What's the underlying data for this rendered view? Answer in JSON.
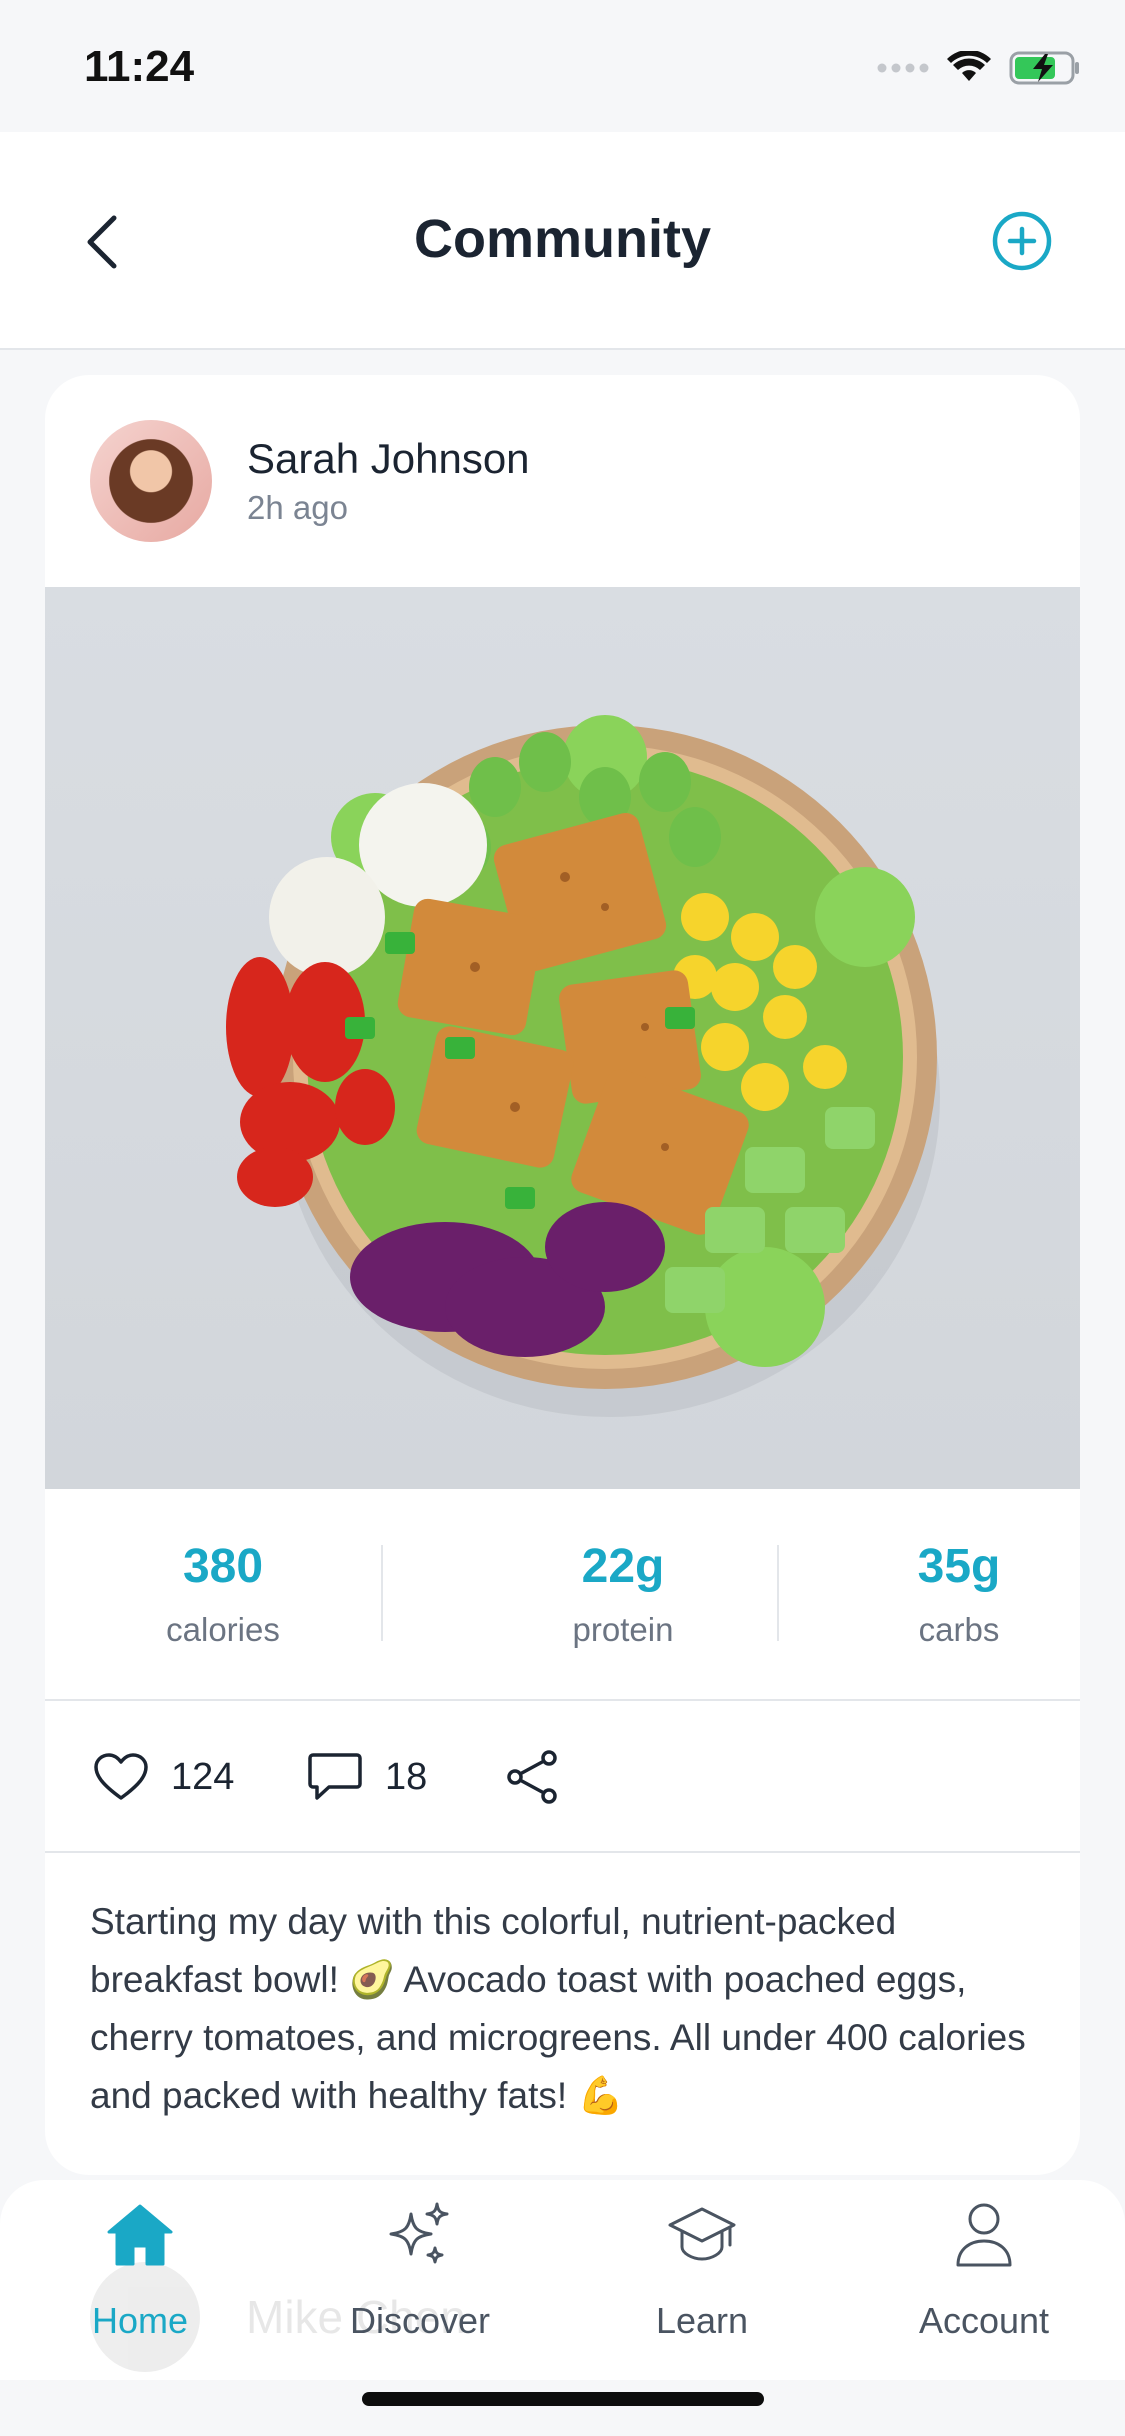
{
  "status_bar": {
    "time": "11:24"
  },
  "nav": {
    "title": "Community"
  },
  "post": {
    "author": "Sarah Johnson",
    "time_ago": "2h ago",
    "macros": [
      {
        "value": "380",
        "label": "calories"
      },
      {
        "value": "22g",
        "label": "protein"
      },
      {
        "value": "35g",
        "label": "carbs"
      }
    ],
    "likes": "124",
    "comments": "18",
    "text": "Starting my day with this colorful, nutrient-packed breakfast bowl! 🥑 Avocado toast with poached eggs, cherry tomatoes, and microgreens. All under 400 calories and packed with healthy fats! 💪"
  },
  "next_post_author": "Mike Chen",
  "tabs": [
    {
      "label": "Home",
      "icon": "home-icon",
      "active": true
    },
    {
      "label": "Discover",
      "icon": "sparkles-icon",
      "active": false
    },
    {
      "label": "Learn",
      "icon": "graduation-cap-icon",
      "active": false
    },
    {
      "label": "Account",
      "icon": "user-icon",
      "active": false
    }
  ],
  "colors": {
    "accent": "#1aa8c6",
    "text": "#1b2431",
    "muted": "#6b7482",
    "inactive_tab": "#4a5461"
  }
}
